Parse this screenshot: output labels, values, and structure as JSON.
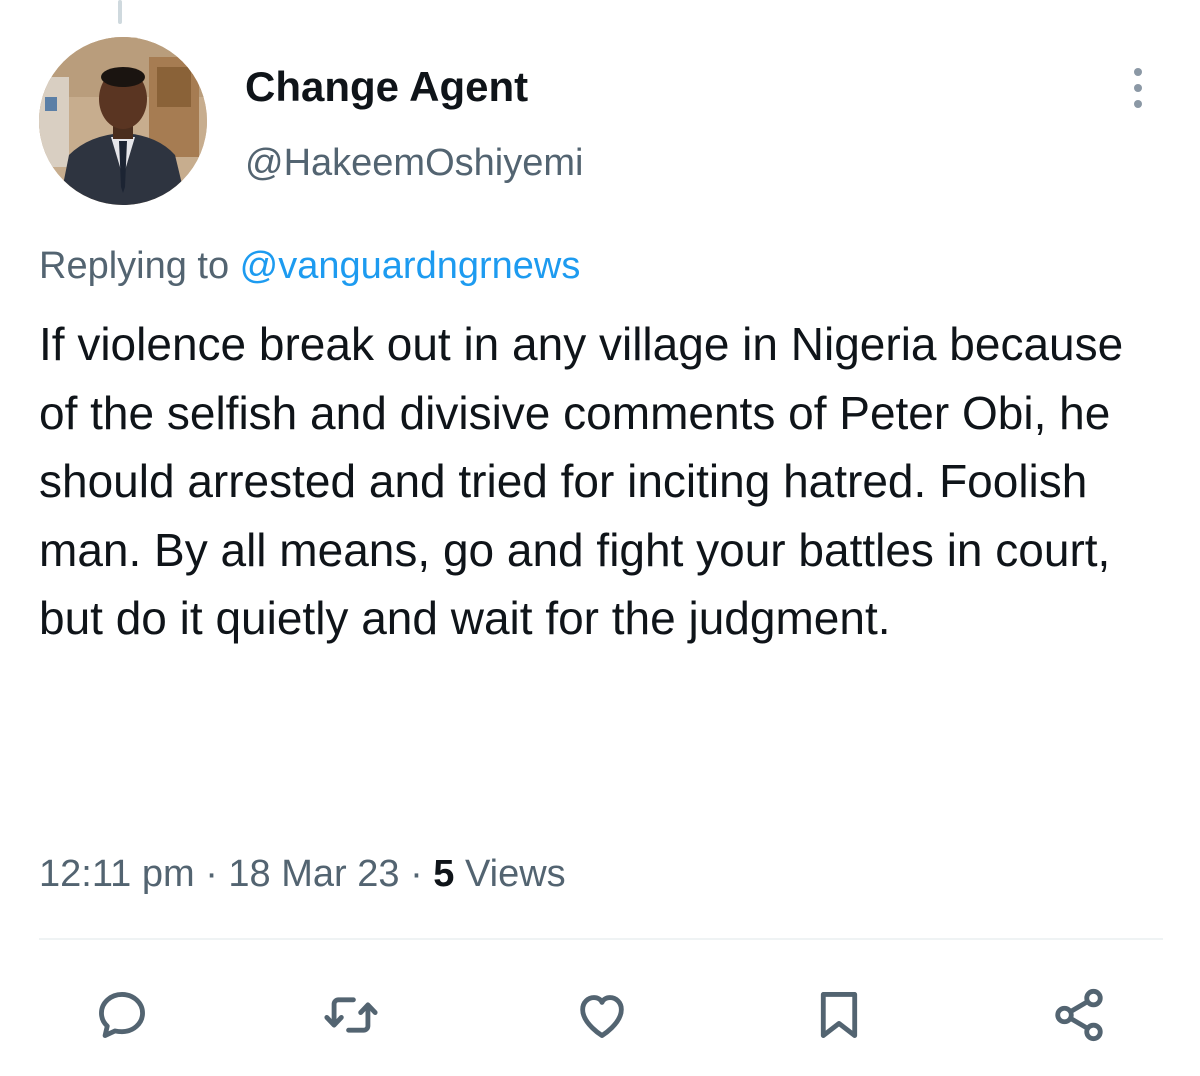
{
  "author": {
    "display_name": "Change Agent",
    "handle": "@HakeemOshiyemi",
    "avatar_icon": "profile-photo"
  },
  "reply": {
    "prefix": "Replying to ",
    "mention": "@vanguardngrnews"
  },
  "tweet": {
    "text": "If violence break out in any village in Nigeria because of the selfish and divisive comments of Peter Obi, he should arrested and tried for inciting hatred. Foolish man. By all means, go and fight your battles in court, but do it quietly and wait for the judgment."
  },
  "meta": {
    "time": "12:11 pm",
    "separator": "·",
    "date": "18 Mar 23",
    "views_count": "5",
    "views_label": " Views"
  },
  "actions": [
    {
      "name": "reply",
      "icon": "reply-icon"
    },
    {
      "name": "retweet",
      "icon": "retweet-icon"
    },
    {
      "name": "like",
      "icon": "heart-icon"
    },
    {
      "name": "bookmark",
      "icon": "bookmark-icon"
    },
    {
      "name": "share",
      "icon": "share-icon"
    }
  ],
  "colors": {
    "accent": "#1d9bf0",
    "secondary_text": "#536471",
    "icon": "#536471"
  }
}
